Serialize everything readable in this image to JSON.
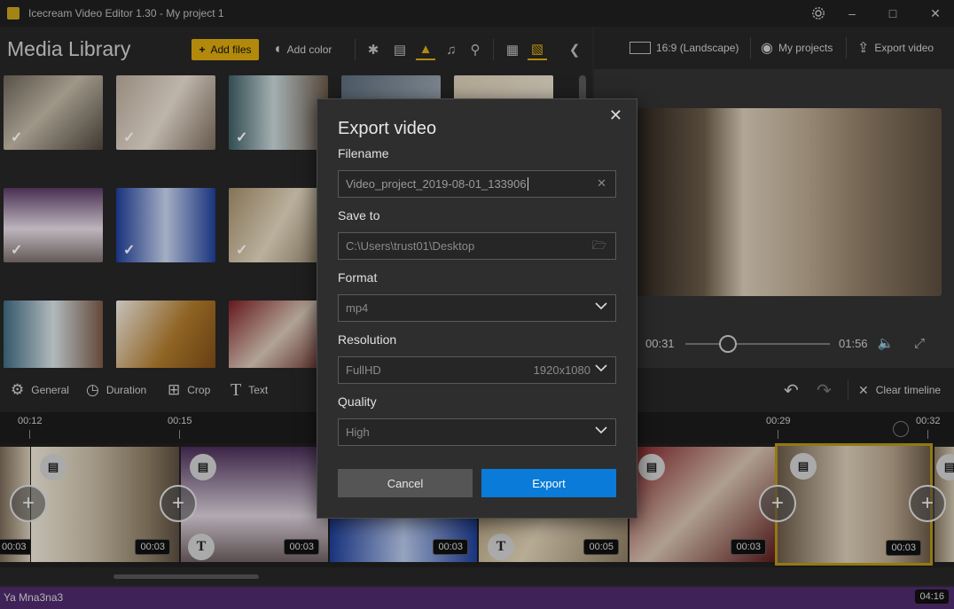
{
  "window": {
    "title": "Icecream Video Editor 1.30 - My project 1"
  },
  "library": {
    "title": "Media Library",
    "add_files": "Add files",
    "add_color": "Add color"
  },
  "header": {
    "aspect": "16:9 (Landscape)",
    "my_projects": "My projects",
    "export_video": "Export video"
  },
  "player": {
    "current_time": "00:31",
    "total_time": "01:56",
    "position_fraction": 0.27
  },
  "tools": {
    "general": "General",
    "duration": "Duration",
    "crop": "Crop",
    "text": "Text",
    "clear_timeline": "Clear timeline"
  },
  "ruler": {
    "ticks": [
      "00:12",
      "00:15",
      "00:29",
      "00:32"
    ]
  },
  "clips": [
    {
      "duration": "00:03"
    },
    {
      "duration": "00:03"
    },
    {
      "duration": "00:03"
    },
    {
      "duration": "00:03"
    },
    {
      "duration": "00:05"
    },
    {
      "duration": "00:03"
    },
    {
      "duration": "00:03"
    }
  ],
  "audio": {
    "label": "Ya Mna3na3",
    "duration": "04:16"
  },
  "dialog": {
    "title": "Export video",
    "filename_label": "Filename",
    "filename_value": "Video_project_2019-08-01_133906",
    "save_to_label": "Save to",
    "save_to_value": "C:\\Users\\trust01\\Desktop",
    "format_label": "Format",
    "format_value": "mp4",
    "resolution_label": "Resolution",
    "resolution_value": "FullHD",
    "resolution_detail": "1920x1080",
    "quality_label": "Quality",
    "quality_value": "High",
    "cancel": "Cancel",
    "export": "Export"
  },
  "colors": {
    "accent": "#d9a80e",
    "export_button": "#0a7bd8",
    "audio_track": "#4d2a6b"
  }
}
